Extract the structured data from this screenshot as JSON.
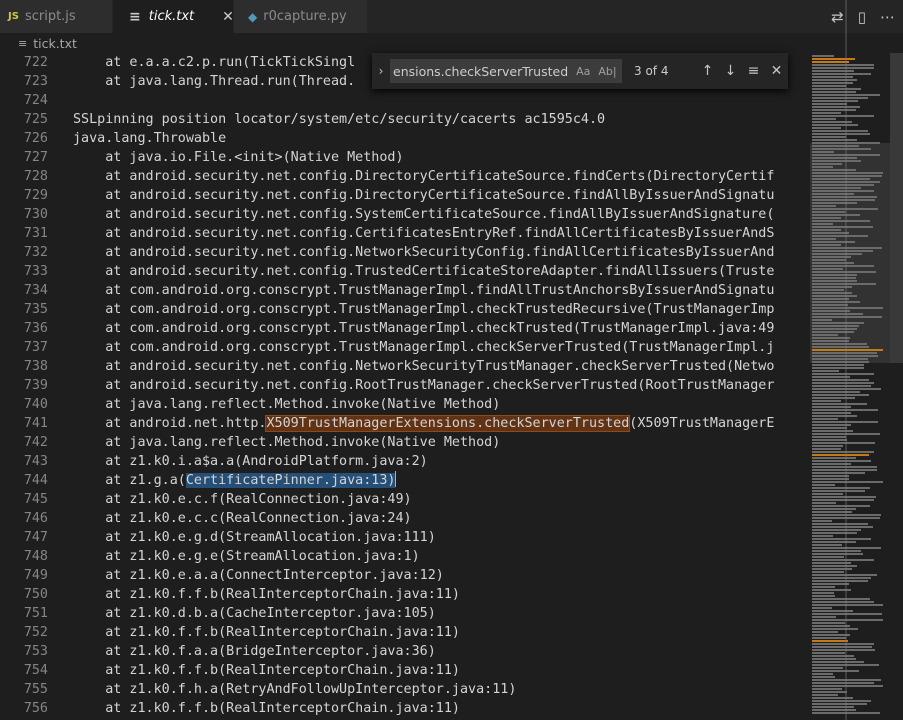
{
  "tabs": [
    {
      "icon": "JS",
      "label": "script.js"
    },
    {
      "icon": "≡",
      "label": "tick.txt",
      "close": "✕"
    },
    {
      "icon": "◆",
      "label": "r0capture.py"
    }
  ],
  "tab_actions": [
    "⇄",
    "▯",
    "⋯"
  ],
  "breadcrumb": {
    "icon": "≡",
    "label": "tick.txt"
  },
  "find": {
    "query": "ensions.checkServerTrusted",
    "opt_case": "Aa",
    "opt_word": "Ab|",
    "opt_regex": ".*",
    "count": "3 of 4",
    "prev": "↑",
    "next": "↓",
    "selection": "≡",
    "close": "✕",
    "toggle": "›"
  },
  "lines": [
    {
      "n": "722",
      "text": "    at e.a.a.c2.p.run(TickTickSingl"
    },
    {
      "n": "723",
      "text": "    at java.lang.Thread.run(Thread."
    },
    {
      "n": "724",
      "text": ""
    },
    {
      "n": "725",
      "text": "SSLpinning position locator/system/etc/security/cacerts ac1595c4.0"
    },
    {
      "n": "726",
      "text": "java.lang.Throwable"
    },
    {
      "n": "727",
      "text": "    at java.io.File.<init>(Native Method)"
    },
    {
      "n": "728",
      "text": "    at android.security.net.config.DirectoryCertificateSource.findCerts(DirectoryCertif"
    },
    {
      "n": "729",
      "text": "    at android.security.net.config.DirectoryCertificateSource.findAllByIssuerAndSignatu"
    },
    {
      "n": "730",
      "text": "    at android.security.net.config.SystemCertificateSource.findAllByIssuerAndSignature("
    },
    {
      "n": "731",
      "text": "    at android.security.net.config.CertificatesEntryRef.findAllCertificatesByIssuerAndS"
    },
    {
      "n": "732",
      "text": "    at android.security.net.config.NetworkSecurityConfig.findAllCertificatesByIssuerAnd"
    },
    {
      "n": "733",
      "text": "    at android.security.net.config.TrustedCertificateStoreAdapter.findAllIssuers(Truste"
    },
    {
      "n": "734",
      "text": "    at com.android.org.conscrypt.TrustManagerImpl.findAllTrustAnchorsByIssuerAndSignatu"
    },
    {
      "n": "735",
      "text": "    at com.android.org.conscrypt.TrustManagerImpl.checkTrustedRecursive(TrustManagerImp"
    },
    {
      "n": "736",
      "text": "    at com.android.org.conscrypt.TrustManagerImpl.checkTrusted(TrustManagerImpl.java:49"
    },
    {
      "n": "737",
      "text": "    at com.android.org.conscrypt.TrustManagerImpl.checkServerTrusted(TrustManagerImpl.j"
    },
    {
      "n": "738",
      "text": "    at android.security.net.config.NetworkSecurityTrustManager.checkServerTrusted(Netwo"
    },
    {
      "n": "739",
      "text": "    at android.security.net.config.RootTrustManager.checkServerTrusted(RootTrustManager"
    },
    {
      "n": "740",
      "text": "    at java.lang.reflect.Method.invoke(Native Method)"
    },
    {
      "n": "741",
      "pre": "    at android.net.http.",
      "hl": "X509TrustManagerExtensions.checkServerTrusted",
      "post": "(X509TrustManagerE"
    },
    {
      "n": "742",
      "text": "    at java.lang.reflect.Method.invoke(Native Method)"
    },
    {
      "n": "743",
      "text": "    at z1.k0.i.a$a.a(AndroidPlatform.java:2)"
    },
    {
      "n": "744",
      "pre": "    at z1.g.a(",
      "sel": "CertificatePinner.java:13)",
      "post": ""
    },
    {
      "n": "745",
      "text": "    at z1.k0.e.c.f(RealConnection.java:49)"
    },
    {
      "n": "746",
      "text": "    at z1.k0.e.c.c(RealConnection.java:24)"
    },
    {
      "n": "747",
      "text": "    at z1.k0.e.g.d(StreamAllocation.java:111)"
    },
    {
      "n": "748",
      "text": "    at z1.k0.e.g.e(StreamAllocation.java:1)"
    },
    {
      "n": "749",
      "text": "    at z1.k0.e.a.a(ConnectInterceptor.java:12)"
    },
    {
      "n": "750",
      "text": "    at z1.k0.f.f.b(RealInterceptorChain.java:11)"
    },
    {
      "n": "751",
      "text": "    at z1.k0.d.b.a(CacheInterceptor.java:105)"
    },
    {
      "n": "752",
      "text": "    at z1.k0.f.f.b(RealInterceptorChain.java:11)"
    },
    {
      "n": "753",
      "text": "    at z1.k0.f.a.a(BridgeInterceptor.java:36)"
    },
    {
      "n": "754",
      "text": "    at z1.k0.f.f.b(RealInterceptorChain.java:11)"
    },
    {
      "n": "755",
      "text": "    at z1.k0.f.h.a(RetryAndFollowUpInterceptor.java:11)"
    },
    {
      "n": "756",
      "text": "    at z1.k0.f.f.b(RealInterceptorChain.java:11)"
    }
  ]
}
